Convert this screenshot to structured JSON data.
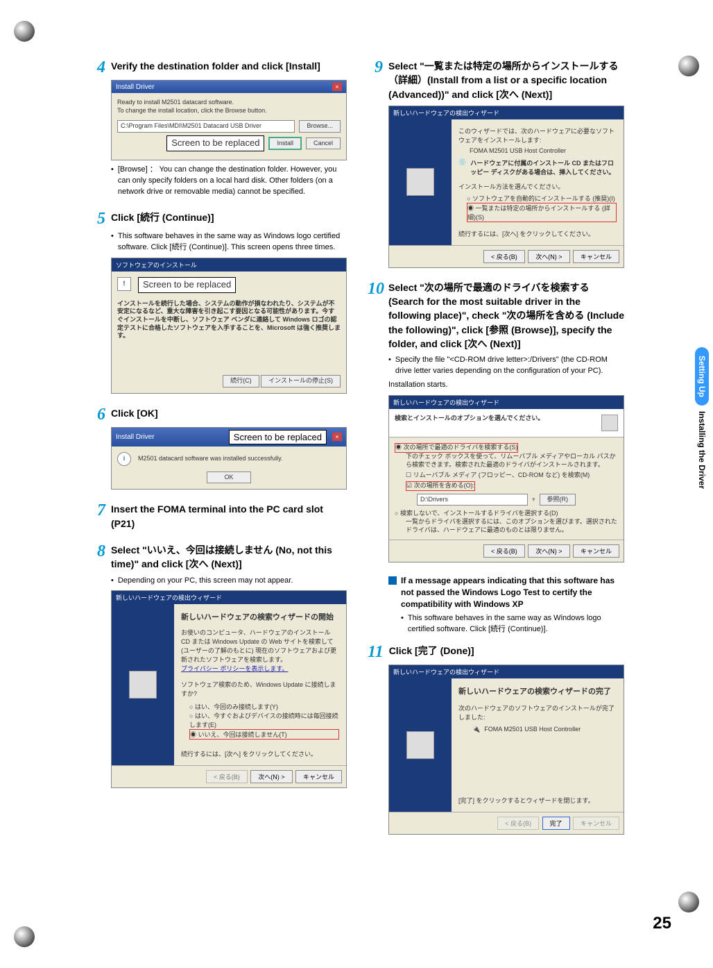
{
  "sidebar": {
    "blue_label": "Setting Up",
    "black_label": "Installing the Driver"
  },
  "page_number": "25",
  "replace_label": "Screen to be replaced",
  "left": {
    "s4": {
      "num": "4",
      "title": "Verify the destination folder and click [Install]",
      "dlg_title": "Install Driver",
      "dlg_line1": "Ready to install M2501 datacard software.",
      "dlg_line2": "To change the install location, click the Browse button.",
      "dlg_path": "C:\\Program Files\\MDI\\M2501 Datacard USB Driver",
      "btn_browse": "Browse...",
      "btn_install": "Install",
      "btn_cancel": "Cancel",
      "bullet": "[Browse] ： You can change the destination folder. However, you can only specify folders on a local hard disk. Other folders (on a network drive or removable media) cannot be specified."
    },
    "s5": {
      "num": "5",
      "title": "Click [続行 (Continue)]",
      "bullet": "This software behaves in the same way as Windows logo certified software. Click [続行 (Continue)]. This screen opens three times.",
      "dlg_title": "ソフトウェアのインストール",
      "dlg_body": "インストールを続行した場合、システムの動作が損なわれたり、システムが不安定になるなど、重大な障害を引き起こす要因となる可能性があります。今すぐインストールを中断し、ソフトウェア ベンダに連絡して Windows ロゴの認定テストに合格したソフトウェアを入手することを、Microsoft は強く推奨します。",
      "btn_continue": "続行(C)",
      "btn_stop": "インストールの停止(S)"
    },
    "s6": {
      "num": "6",
      "title": "Click [OK]",
      "dlg_title": "Install Driver",
      "dlg_msg": "M2501 datacard software was installed successfully.",
      "btn_ok": "OK"
    },
    "s7": {
      "num": "7",
      "title": "Insert the FOMA terminal into the PC card slot (P21)"
    },
    "s8": {
      "num": "8",
      "title": "Select \"いいえ、今回は接続しません (No, not this time)\" and click [次へ (Next)]",
      "bullet": "Depending on your PC, this screen may not appear.",
      "dlg_title": "新しいハードウェアの検出ウィザード",
      "h": "新しいハードウェアの検索ウィザードの開始",
      "body1": "お使いのコンピュータ、ハードウェアのインストール CD または Windows Update の Web サイトを検索して (ユーザーの了解のもとに) 現在のソフトウェアおよび更新されたソフトウェアを検索します。",
      "body_link": "プライバシー ポリシーを表示します。",
      "q": "ソフトウェア検索のため、Windows Update に接続しますか?",
      "opt1": "はい、今回のみ接続します(Y)",
      "opt2": "はい、今すぐおよびデバイスの接続時には毎回接続します(E)",
      "opt3": "いいえ、今回は接続しません(T)",
      "footer": "続行するには、[次へ] をクリックしてください。",
      "btn_back": "< 戻る(B)",
      "btn_next": "次へ(N) >",
      "btn_cancel": "キャンセル"
    }
  },
  "right": {
    "s9": {
      "num": "9",
      "title": "Select \"一覧または特定の場所からインストールする（詳細）(Install from a list or a specific location (Advanced))\" and click [次へ (Next)]",
      "dlg_title": "新しいハードウェアの検出ウィザード",
      "body1": "このウィザードでは、次のハードウェアに必要なソフトウェアをインストールします:",
      "dev": "FOMA M2501 USB Host Controller",
      "cd": "ハードウェアに付属のインストール CD またはフロッピー ディスクがある場合は、挿入してください。",
      "q": "インストール方法を選んでください。",
      "opt1": "ソフトウェアを自動的にインストールする (推奨)(I)",
      "opt2": "一覧または特定の場所からインストールする (詳細)(S)",
      "footer": "続行するには、[次へ] をクリックしてください。",
      "btn_back": "< 戻る(B)",
      "btn_next": "次へ(N) >",
      "btn_cancel": "キャンセル"
    },
    "s10": {
      "num": "10",
      "title": "Select \"次の場所で最適のドライバを検索する (Search for the most suitable driver in the following place)\", check \"次の場所を含める (Include the following)\", click [参照 (Browse)], specify the folder, and click [次へ (Next)]",
      "bullet": "Specify the file \"<CD-ROM drive letter>:/Drivers\" (the CD-ROM drive letter varies depending on the configuration of your PC).",
      "sub": "Installation starts.",
      "dlg_title": "新しいハードウェアの検出ウィザード",
      "h": "検索とインストールのオプションを選んでください。",
      "opt1": "次の場所で最適のドライバを検索する(S)",
      "opt1_desc": "下のチェック ボックスを使って、リムーバブル メディアやローカル パスから検索できます。検索された最適のドライバがインストールされます。",
      "chk1": "リムーバブル メディア (フロッピー、CD-ROM など) を検索(M)",
      "chk2": "次の場所を含める(O):",
      "path": "D:\\Drivers",
      "btn_browse": "参照(R)",
      "opt2": "検索しないで、インストールするドライバを選択する(D)",
      "opt2_desc": "一覧からドライバを選択するには、このオプションを選びます。選択されたドライバは、ハードウェアに最適のものとは限りません。",
      "btn_back": "< 戻る(B)",
      "btn_next": "次へ(N) >",
      "btn_cancel": "キャンセル"
    },
    "info": {
      "head": "If a message appears indicating that this software has not passed the Windows Logo Test to certify the compatibility with Windows XP",
      "bullet": "This software behaves in the same way as Windows logo certified software. Click [続行 (Continue)]."
    },
    "s11": {
      "num": "11",
      "title": "Click [完了 (Done)]",
      "dlg_title": "新しいハードウェアの検出ウィザード",
      "h": "新しいハードウェアの検索ウィザードの完了",
      "body": "次のハードウェアのソフトウェアのインストールが完了しました:",
      "dev": "FOMA M2501 USB Host Controller",
      "footer": "[完了] をクリックするとウィザードを閉じます。",
      "btn_back": "< 戻る(B)",
      "btn_done": "完了",
      "btn_cancel": "キャンセル"
    }
  }
}
